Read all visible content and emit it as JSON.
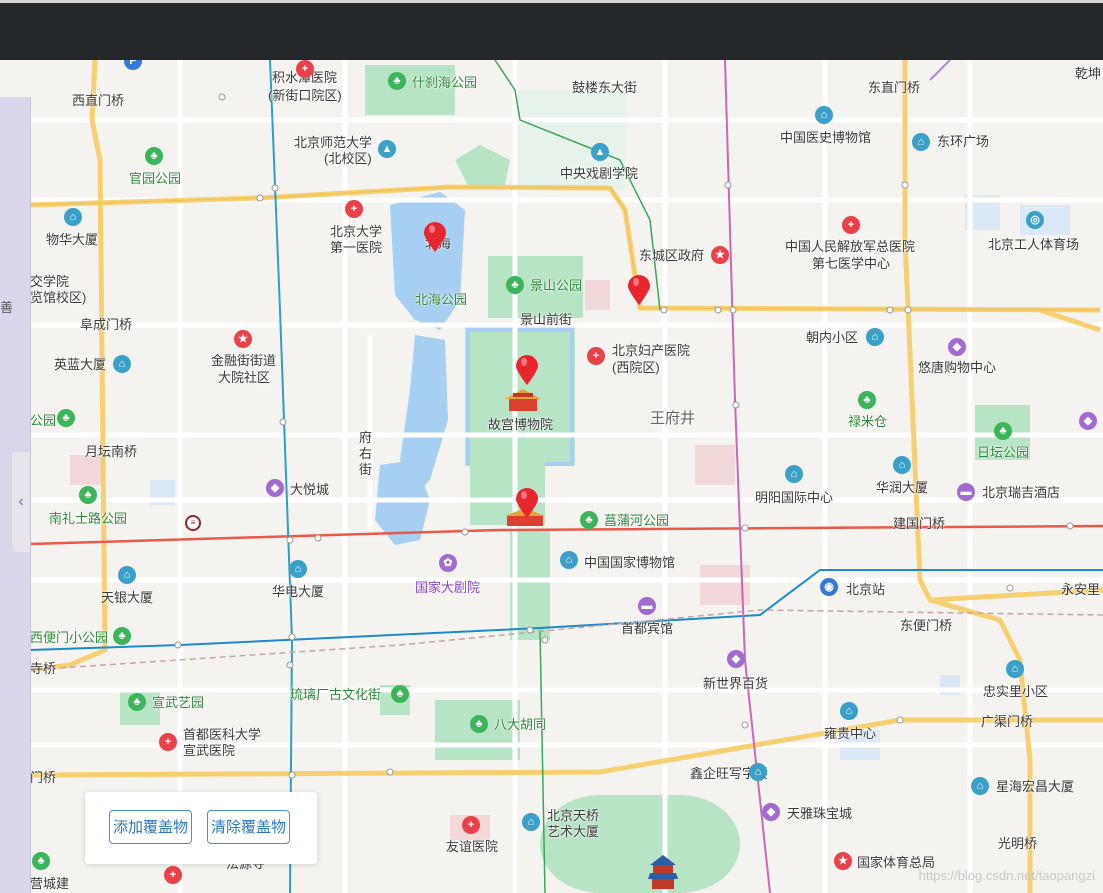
{
  "controls": {
    "add_overlay": "添加覆盖物",
    "clear_overlay": "清除覆盖物",
    "collapse_icon": "‹"
  },
  "watermark": "https://blog.csdn.net/taopangzi",
  "map": {
    "labels": [
      {
        "text": "积水潭医院",
        "cls": ""
      },
      {
        "text": "(新街口院区)",
        "cls": ""
      },
      {
        "text": "什刹海公园",
        "cls": "green"
      },
      {
        "text": "鼓楼东大街",
        "cls": ""
      },
      {
        "text": "东直门桥",
        "cls": ""
      },
      {
        "text": "乾坤",
        "cls": ""
      },
      {
        "text": "西直门桥",
        "cls": ""
      },
      {
        "text": "北京师范大学",
        "cls": ""
      },
      {
        "text": "(北校区)",
        "cls": ""
      },
      {
        "text": "中国医史博物馆",
        "cls": ""
      },
      {
        "text": "东环广场",
        "cls": ""
      },
      {
        "text": "官园公园",
        "cls": "green"
      },
      {
        "text": "中央戏剧学院",
        "cls": ""
      },
      {
        "text": "物华大厦",
        "cls": ""
      },
      {
        "text": "北京大学",
        "cls": ""
      },
      {
        "text": "第一医院",
        "cls": ""
      },
      {
        "text": "北海",
        "cls": ""
      },
      {
        "text": "中国人民解放军总医院",
        "cls": ""
      },
      {
        "text": "第七医学中心",
        "cls": ""
      },
      {
        "text": "北京工人体育场",
        "cls": ""
      },
      {
        "text": "东城区政府",
        "cls": ""
      },
      {
        "text": "景山公园",
        "cls": "green"
      },
      {
        "text": "交学院",
        "cls": ""
      },
      {
        "text": "览馆校区)",
        "cls": ""
      },
      {
        "text": "北海公园",
        "cls": "green"
      },
      {
        "text": "景山前街",
        "cls": ""
      },
      {
        "text": "阜成门桥",
        "cls": ""
      },
      {
        "text": "朝内小区",
        "cls": ""
      },
      {
        "text": "金融街街道",
        "cls": ""
      },
      {
        "text": "大院社区",
        "cls": ""
      },
      {
        "text": "北京妇产医院",
        "cls": ""
      },
      {
        "text": "(西院区)",
        "cls": ""
      },
      {
        "text": "悠唐购物中心",
        "cls": ""
      },
      {
        "text": "英蓝大厦",
        "cls": ""
      },
      {
        "text": "禄米仓",
        "cls": "green"
      },
      {
        "text": "王府井",
        "cls": "district"
      },
      {
        "text": "故宫博物院",
        "cls": ""
      },
      {
        "text": "府",
        "cls": ""
      },
      {
        "text": "右",
        "cls": ""
      },
      {
        "text": "街",
        "cls": ""
      },
      {
        "text": "公园",
        "cls": "green"
      },
      {
        "text": "月坛南桥",
        "cls": ""
      },
      {
        "text": "日坛公园",
        "cls": "green"
      },
      {
        "text": "明阳国际中心",
        "cls": ""
      },
      {
        "text": "华润大厦",
        "cls": ""
      },
      {
        "text": "北京瑞吉酒店",
        "cls": ""
      },
      {
        "text": "大悦城",
        "cls": ""
      },
      {
        "text": "南礼士路公园",
        "cls": "green"
      },
      {
        "text": "菖蒲河公园",
        "cls": "green"
      },
      {
        "text": "建国门桥",
        "cls": ""
      },
      {
        "text": "中国国家博物馆",
        "cls": ""
      },
      {
        "text": "北京站",
        "cls": ""
      },
      {
        "text": "永安里",
        "cls": ""
      },
      {
        "text": "国家大剧院",
        "cls": "purple"
      },
      {
        "text": "天银大厦",
        "cls": ""
      },
      {
        "text": "华电大厦",
        "cls": ""
      },
      {
        "text": "首都宾馆",
        "cls": ""
      },
      {
        "text": "东便门桥",
        "cls": ""
      },
      {
        "text": "西便门小公园",
        "cls": "green"
      },
      {
        "text": "寺桥",
        "cls": ""
      },
      {
        "text": "新世界百货",
        "cls": ""
      },
      {
        "text": "忠实里小区",
        "cls": ""
      },
      {
        "text": "琉璃厂古文化街",
        "cls": "green"
      },
      {
        "text": "宣武艺园",
        "cls": "green"
      },
      {
        "text": "八大胡同",
        "cls": "green"
      },
      {
        "text": "广渠门桥",
        "cls": ""
      },
      {
        "text": "首都医科大学",
        "cls": ""
      },
      {
        "text": "宣武医院",
        "cls": ""
      },
      {
        "text": "雍贵中心",
        "cls": ""
      },
      {
        "text": "鑫企旺写字楼",
        "cls": ""
      },
      {
        "text": "星海宏昌大厦",
        "cls": ""
      },
      {
        "text": "门桥",
        "cls": ""
      },
      {
        "text": "天雅珠宝城",
        "cls": ""
      },
      {
        "text": "北京天桥",
        "cls": ""
      },
      {
        "text": "艺术大厦",
        "cls": ""
      },
      {
        "text": "友谊医院",
        "cls": ""
      },
      {
        "text": "光明桥",
        "cls": ""
      },
      {
        "text": "国家体育总局",
        "cls": ""
      },
      {
        "text": "营城建",
        "cls": ""
      },
      {
        "text": "法源寺",
        "cls": ""
      }
    ],
    "poi_icons": [
      {
        "name": "hospital-icon",
        "color": "red"
      },
      {
        "name": "park-icon",
        "color": "green"
      },
      {
        "name": "school-icon",
        "color": "teal"
      },
      {
        "name": "museum-icon",
        "color": "teal"
      },
      {
        "name": "shopping-icon",
        "color": "purple"
      },
      {
        "name": "hotel-icon",
        "color": "purple"
      },
      {
        "name": "government-icon",
        "color": "red"
      },
      {
        "name": "station-icon",
        "color": "blue"
      }
    ],
    "markers": [
      "北海",
      "东城区政府",
      "故宫博物院",
      "天安门"
    ]
  },
  "colors": {
    "topbar": "#24272a",
    "water": "#a6cff2",
    "park": "#b7e4c4",
    "road_major": "#f6d070",
    "marker": "#e8262e"
  }
}
